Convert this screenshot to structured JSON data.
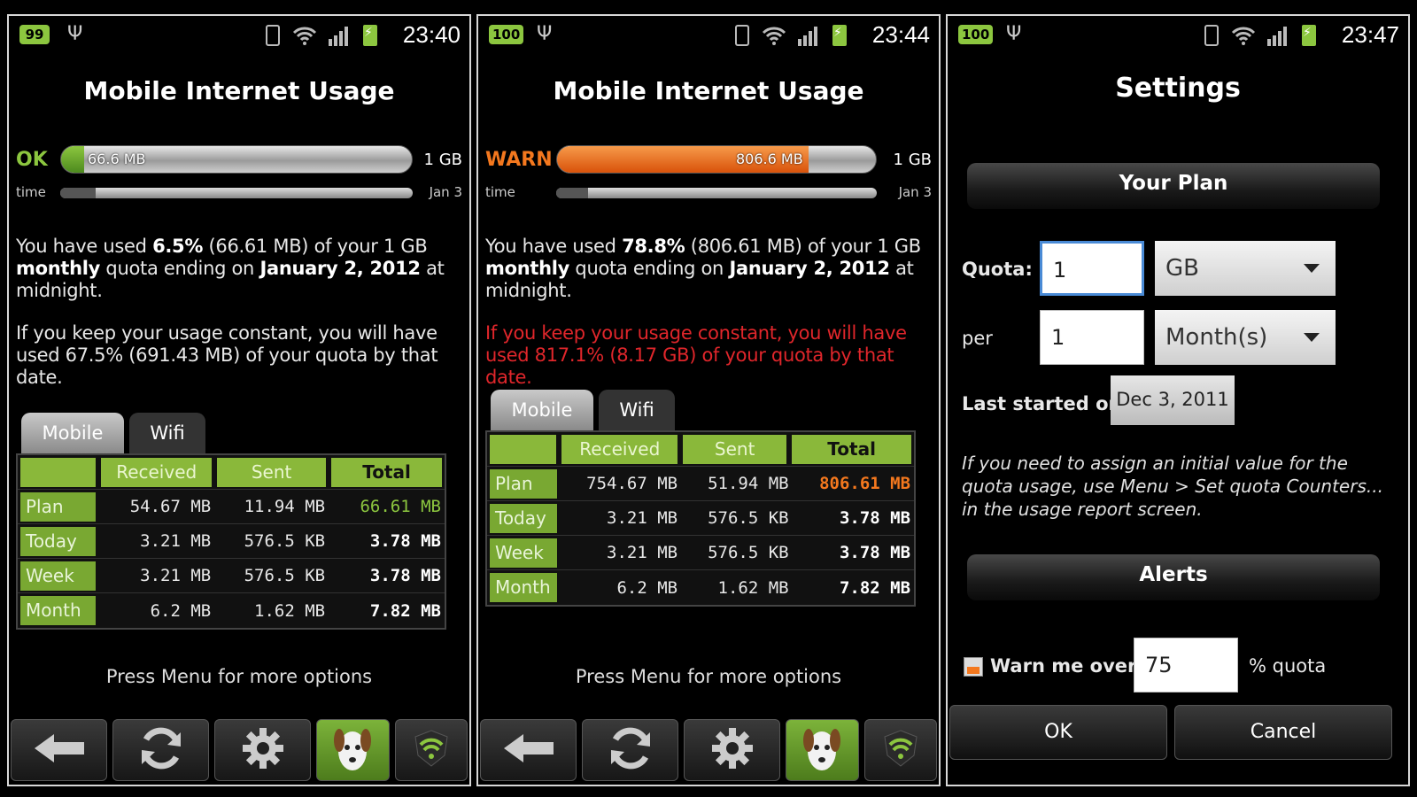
{
  "screens": [
    {
      "status": {
        "battery": "99",
        "time": "23:40"
      },
      "title": "Mobile Internet Usage",
      "gauge": {
        "status": "OK",
        "status_color": "#8cc63f",
        "used_label": "66.6 MB",
        "fraction": 0.065,
        "limit": "1 GB",
        "fill_color": "#6aa534"
      },
      "time_gauge": {
        "label": "time",
        "end": "Jan 3",
        "fraction": 0.1
      },
      "para1": {
        "t1": "You have used ",
        "pct": "6.5%",
        "t2": " (66.61 MB) of your 1 GB ",
        "monthly": "monthly",
        "t3": " quota ending on ",
        "date": "January 2, 2012",
        "t4": " at midnight."
      },
      "para2": "If you keep your usage constant, you will have used 67.5% (691.43 MB) of your quota by that date.",
      "para2_warn": false,
      "tabs": [
        "Mobile",
        "Wifi"
      ],
      "table": {
        "headers": [
          "",
          "Received",
          "Sent",
          "Total"
        ],
        "rows": [
          {
            "label": "Plan",
            "received": "54.67 MB",
            "sent": "11.94 MB",
            "total": "66.61 MB",
            "total_style": "green"
          },
          {
            "label": "Today",
            "received": "3.21 MB",
            "sent": "576.5 KB",
            "total": "3.78 MB",
            "total_style": "tot"
          },
          {
            "label": "Week",
            "received": "3.21 MB",
            "sent": "576.5 KB",
            "total": "3.78 MB",
            "total_style": "tot"
          },
          {
            "label": "Month",
            "received": "6.2 MB",
            "sent": "1.62 MB",
            "total": "7.82 MB",
            "total_style": "tot"
          }
        ]
      },
      "press_menu": "Press Menu for more options"
    },
    {
      "status": {
        "battery": "100",
        "time": "23:44"
      },
      "title": "Mobile Internet Usage",
      "gauge": {
        "status": "WARN",
        "status_color": "#f4781e",
        "used_label": "806.6 MB",
        "fraction": 0.788,
        "limit": "1 GB",
        "fill_color": "#f06a14"
      },
      "time_gauge": {
        "label": "time",
        "end": "Jan 3",
        "fraction": 0.1
      },
      "para1": {
        "t1": "You have used ",
        "pct": "78.8%",
        "t2": " (806.61 MB) of your 1 GB ",
        "monthly": "monthly",
        "t3": " quota ending on ",
        "date": "January 2, 2012",
        "t4": " at midnight."
      },
      "para2": "If you keep your usage constant, you will have used 817.1% (8.17 GB) of your quota by that date.",
      "para2_warn": true,
      "tabs": [
        "Mobile",
        "Wifi"
      ],
      "table": {
        "headers": [
          "",
          "Received",
          "Sent",
          "Total"
        ],
        "rows": [
          {
            "label": "Plan",
            "received": "754.67 MB",
            "sent": "51.94 MB",
            "total": "806.61 MB",
            "total_style": "orange"
          },
          {
            "label": "Today",
            "received": "3.21 MB",
            "sent": "576.5 KB",
            "total": "3.78 MB",
            "total_style": "tot"
          },
          {
            "label": "Week",
            "received": "3.21 MB",
            "sent": "576.5 KB",
            "total": "3.78 MB",
            "total_style": "tot"
          },
          {
            "label": "Month",
            "received": "6.2 MB",
            "sent": "1.62 MB",
            "total": "7.82 MB",
            "total_style": "tot"
          }
        ]
      },
      "press_menu": "Press Menu for more options"
    }
  ],
  "toolbar_icons": [
    "back-arrow-icon",
    "refresh-icon",
    "gear-icon",
    "dog-icon",
    "shield-wifi-icon"
  ],
  "settings": {
    "status": {
      "battery": "100",
      "time": "23:47"
    },
    "title": "Settings",
    "your_plan": "Your Plan",
    "quota_label": "Quota:",
    "quota_value": "1",
    "quota_unit": "GB",
    "per_label": "per",
    "per_value": "1",
    "per_unit": "Month(s)",
    "last_started_label": "Last started on",
    "last_started_value": "Dec 3, 2011",
    "note": "If you need to assign an initial value for the quota usage, use Menu > Set quota Counters... in the usage report screen.",
    "alerts": "Alerts",
    "warn_label": "Warn me over",
    "warn_value": "75",
    "warn_suffix": "% quota",
    "ok": "OK",
    "cancel": "Cancel"
  }
}
